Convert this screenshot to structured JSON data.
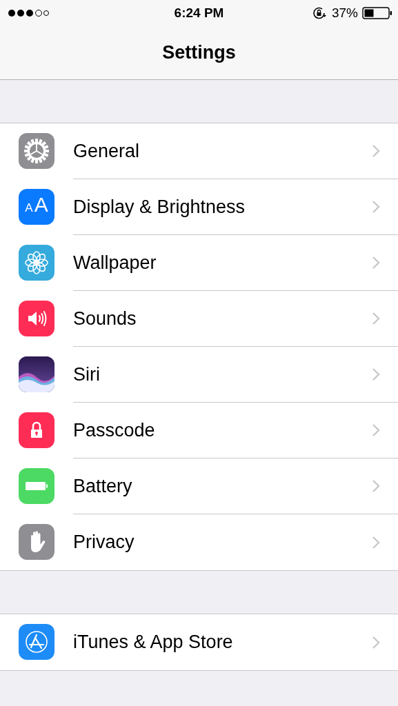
{
  "status_bar": {
    "time": "6:24 PM",
    "battery": "37%"
  },
  "nav_bar": {
    "title": "Settings"
  },
  "groups": [
    {
      "items": [
        {
          "label": "General",
          "kind": "gear"
        },
        {
          "label": "Display & Brightness",
          "kind": "display",
          "icon_letters": [
            "A",
            "A"
          ]
        },
        {
          "label": "Wallpaper",
          "kind": "flower"
        },
        {
          "label": "Sounds",
          "kind": "speaker"
        },
        {
          "label": "Siri",
          "kind": "siri"
        },
        {
          "label": "Passcode",
          "kind": "lock"
        },
        {
          "label": "Battery",
          "kind": "battery"
        },
        {
          "label": "Privacy",
          "kind": "hand"
        }
      ]
    },
    {
      "items": [
        {
          "label": "iTunes & App Store",
          "kind": "appstore"
        }
      ]
    }
  ]
}
